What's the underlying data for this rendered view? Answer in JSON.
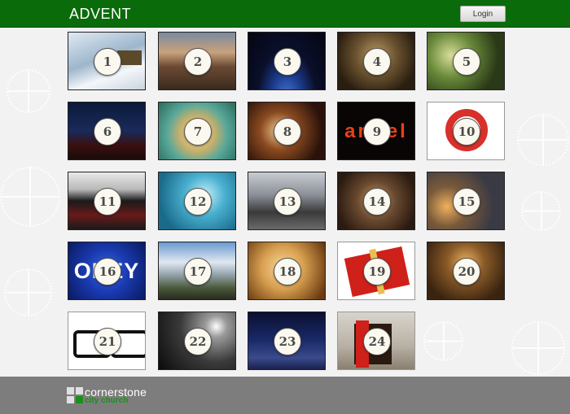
{
  "header": {
    "title": "ADVENT",
    "login_label": "Login"
  },
  "calendar": {
    "days": [
      {
        "number": "1",
        "scene": "truck on icy road"
      },
      {
        "number": "2",
        "scene": "mountain ridge at dusk"
      },
      {
        "number": "3",
        "scene": "earth from space at night"
      },
      {
        "number": "4",
        "scene": "vintage microphone"
      },
      {
        "number": "5",
        "scene": "pine branch with lights"
      },
      {
        "number": "6",
        "scene": "christmas tree and truck"
      },
      {
        "number": "7",
        "scene": "gold table setting"
      },
      {
        "number": "8",
        "scene": "string lights"
      },
      {
        "number": "9",
        "scene": "neon angel sign",
        "overlay_text": "angel"
      },
      {
        "number": "10",
        "scene": "life ring buoy"
      },
      {
        "number": "11",
        "scene": "family in christmas sweaters"
      },
      {
        "number": "12",
        "scene": "blue bokeh decoration"
      },
      {
        "number": "13",
        "scene": "city street crowd"
      },
      {
        "number": "14",
        "scene": "wedding rings"
      },
      {
        "number": "15",
        "scene": "couple with lantern"
      },
      {
        "number": "16",
        "scene": "blue obey sign",
        "overlay_text": "OBEY"
      },
      {
        "number": "17",
        "scene": "snowy mountain village"
      },
      {
        "number": "18",
        "scene": "cherub painting"
      },
      {
        "number": "19",
        "scene": "red gift box"
      },
      {
        "number": "20",
        "scene": "light bulb"
      },
      {
        "number": "21",
        "scene": "eyeglasses"
      },
      {
        "number": "22",
        "scene": "light burst over rocks"
      },
      {
        "number": "23",
        "scene": "night snow landscape"
      },
      {
        "number": "24",
        "scene": "elf at fireplace"
      }
    ]
  },
  "footer": {
    "logo_word": "cornerstone",
    "logo_sub": "city church"
  },
  "colors": {
    "header_green": "#0a6b0a",
    "footer_gray": "#7d7d7d",
    "logo_green": "#1a8f1a"
  }
}
